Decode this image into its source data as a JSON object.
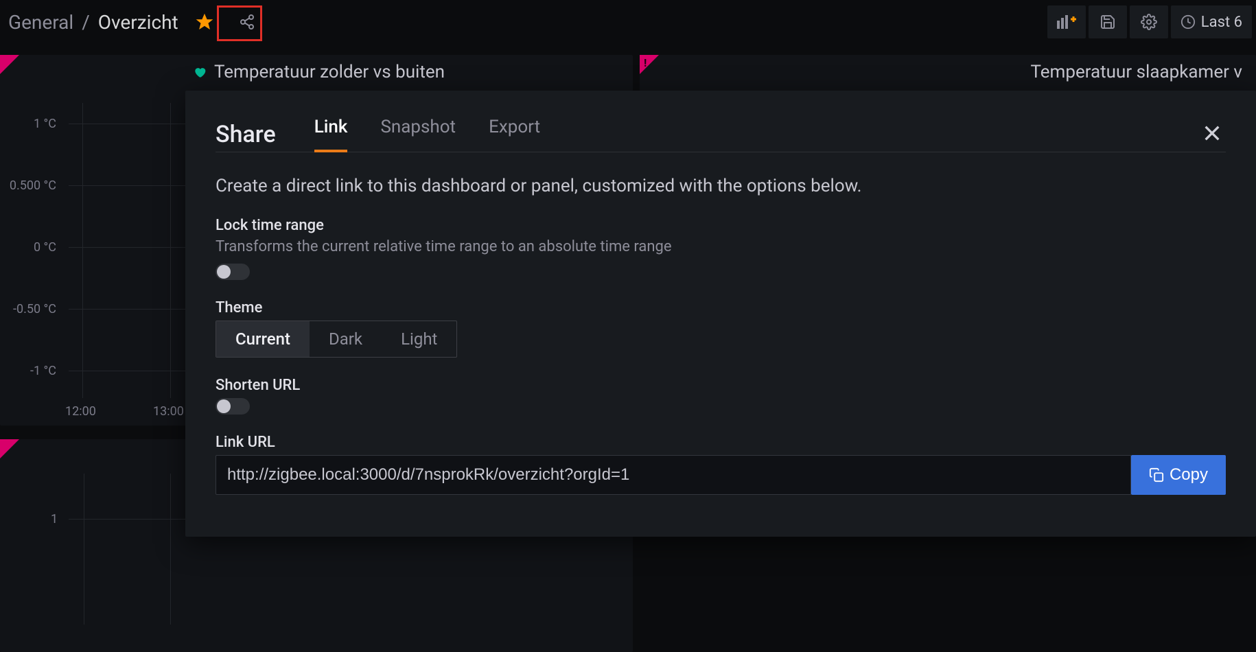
{
  "topbar": {
    "breadcrumb_root": "General",
    "breadcrumb_sep": "/",
    "breadcrumb_current": "Overzicht",
    "time_label": "Last 6"
  },
  "panel_left": {
    "title": "Temperatuur zolder vs buiten",
    "y_ticks": [
      "1 °C",
      "0.500 °C",
      "0 °C",
      "-0.50 °C",
      "-1 °C"
    ],
    "x_ticks": [
      "12:00",
      "13:00"
    ]
  },
  "panel_right": {
    "title": "Temperatuur slaapkamer v"
  },
  "panel_bottom": {
    "y_tick": "1"
  },
  "share": {
    "title": "Share",
    "tabs": {
      "link": "Link",
      "snapshot": "Snapshot",
      "export": "Export"
    },
    "description": "Create a direct link to this dashboard or panel, customized with the options below.",
    "lock_time": {
      "label": "Lock time range",
      "sub": "Transforms the current relative time range to an absolute time range"
    },
    "theme": {
      "label": "Theme",
      "options": {
        "current": "Current",
        "dark": "Dark",
        "light": "Light"
      }
    },
    "shorten": {
      "label": "Shorten URL"
    },
    "link_url": {
      "label": "Link URL",
      "value": "http://zigbee.local:3000/d/7nsprokRk/overzicht?orgId=1",
      "copy": "Copy"
    }
  }
}
